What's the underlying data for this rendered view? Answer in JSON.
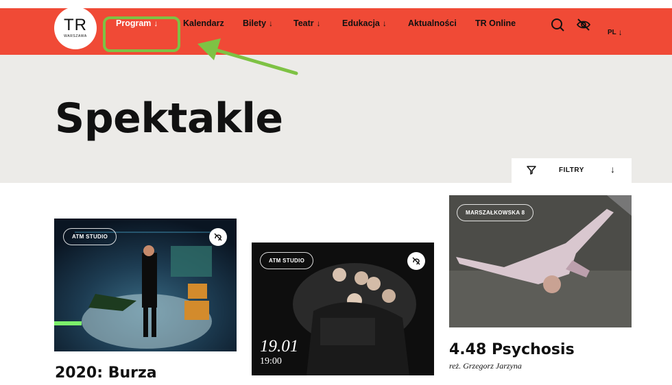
{
  "header": {
    "logo_main": "TR",
    "logo_sub": "WARSZAWA",
    "nav": [
      {
        "label": "Program",
        "has_arrow": true,
        "active": true
      },
      {
        "label": "Kalendarz",
        "has_arrow": false
      },
      {
        "label": "Bilety",
        "has_arrow": true
      },
      {
        "label": "Teatr",
        "has_arrow": true
      },
      {
        "label": "Edukacja",
        "has_arrow": true
      },
      {
        "label": "Aktualności",
        "has_arrow": false
      },
      {
        "label": "TR Online",
        "has_arrow": false
      }
    ],
    "icons": [
      "search-icon",
      "eye-off-icon"
    ],
    "lang": "PL",
    "arrow_glyph": "↓"
  },
  "hero": {
    "title": "Spektakle",
    "filters_label": "FILTRY"
  },
  "cards": [
    {
      "tag": "ATM STUDIO",
      "title": "2020: Burza",
      "has_audio": true
    },
    {
      "tag": "ATM STUDIO",
      "date": "19.01",
      "time": "19:00",
      "has_audio": true
    },
    {
      "tag": "MARSZAŁKOWSKA 8",
      "title": "4.48 Psychosis",
      "director": "reż. Grzegorz Jarzyna"
    }
  ],
  "colors": {
    "header": "#f04a36",
    "hero": "#ecebe8",
    "highlight": "#7ec244"
  }
}
